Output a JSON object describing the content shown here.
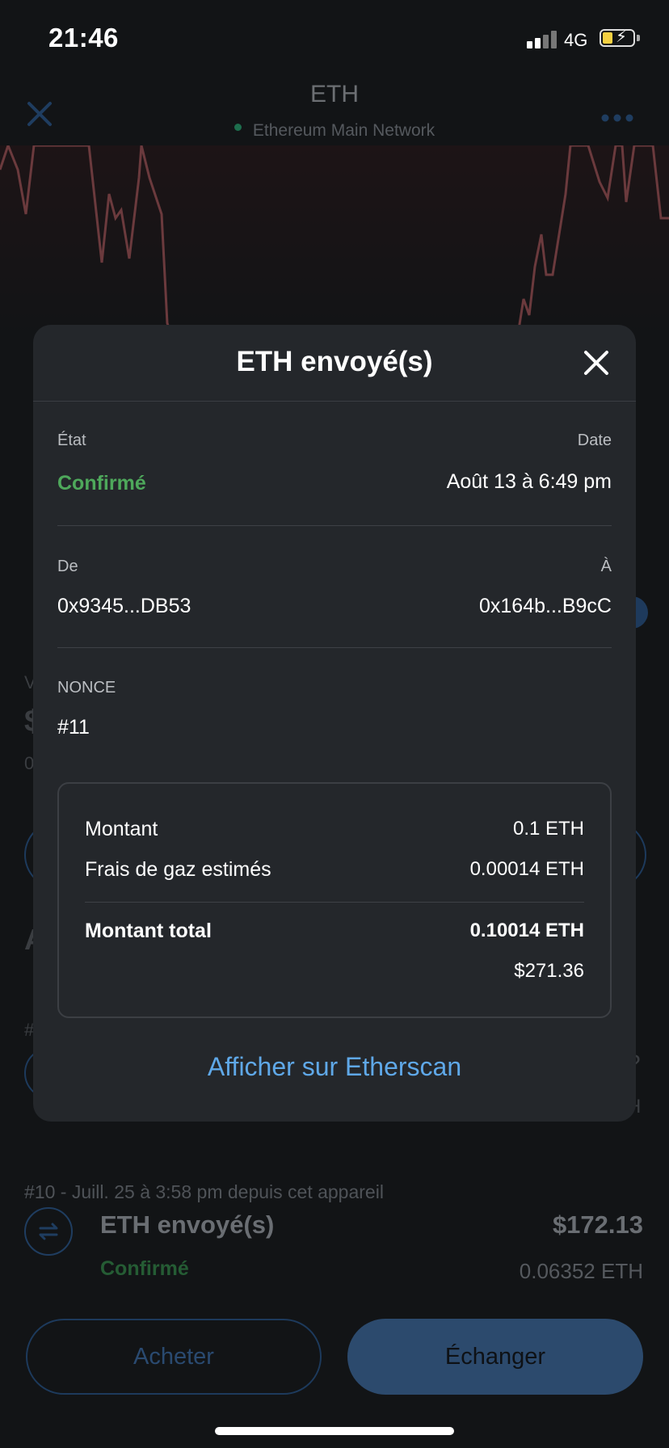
{
  "status_bar": {
    "time": "21:46",
    "network": "4G"
  },
  "header": {
    "title": "ETH",
    "network": "Ethereum Main Network"
  },
  "background": {
    "fragments": [
      "V",
      "$",
      "0",
      "A",
      "#",
      "?",
      "H"
    ],
    "history_item": {
      "meta": "#10 - Juill. 25 à 3:58 pm depuis cet appareil",
      "title": "ETH envoyé(s)",
      "status": "Confirmé",
      "fiat": "$172.13",
      "crypto": "0.06352 ETH"
    }
  },
  "actions": {
    "buy": "Acheter",
    "swap": "Échanger"
  },
  "modal": {
    "title": "ETH envoyé(s)",
    "status_label": "État",
    "status_value": "Confirmé",
    "date_label": "Date",
    "date_value": "Août 13 à 6:49 pm",
    "from_label": "De",
    "from_value": "0x9345...DB53",
    "to_label": "À",
    "to_value": "0x164b...B9cC",
    "nonce_label": "NONCE",
    "nonce_value": "#11",
    "summary": {
      "amount_label": "Montant",
      "amount_value": "0.1 ETH",
      "gas_label": "Frais de gaz estimés",
      "gas_value": "0.00014 ETH",
      "total_label": "Montant total",
      "total_value": "0.10014 ETH",
      "total_fiat": "$271.36"
    },
    "etherscan_link": "Afficher sur Etherscan"
  },
  "colors": {
    "confirmed": "#4ea85b",
    "link": "#5fa8e8",
    "chart_line": "#6b3a3d",
    "accent": "#2c4a6d"
  },
  "icons": [
    "close-icon",
    "more-icon",
    "swap-arrows-icon",
    "signal-icon",
    "battery-icon"
  ]
}
